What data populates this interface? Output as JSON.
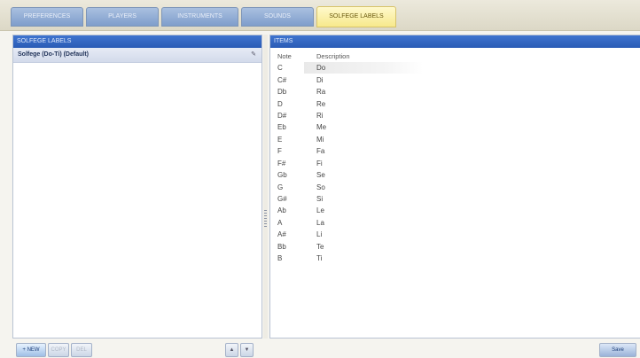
{
  "tabs": [
    {
      "label": "PREFERENCES"
    },
    {
      "label": "PLAYERS"
    },
    {
      "label": "INSTRUMENTS"
    },
    {
      "label": "SOUNDS"
    },
    {
      "label": "SOLFEGE LABELS"
    }
  ],
  "left_panel": {
    "title": "SOLFEGE LABELS",
    "sets": [
      {
        "label": "Solfege (Do-Ti) (Default)",
        "action_icon": "pencil-icon",
        "action_glyph": "✎"
      }
    ],
    "buttons": {
      "new": "+ NEW",
      "copy": "COPY",
      "delete": "DEL",
      "move_up": "▲",
      "move_down": "▼"
    }
  },
  "right_panel": {
    "title": "ITEMS",
    "columns": {
      "note": "Note",
      "description": "Description"
    },
    "rows": [
      {
        "note": "C",
        "desc": "Do"
      },
      {
        "note": "C#",
        "desc": "Di"
      },
      {
        "note": "Db",
        "desc": "Ra"
      },
      {
        "note": "D",
        "desc": "Re"
      },
      {
        "note": "D#",
        "desc": "Ri"
      },
      {
        "note": "Eb",
        "desc": "Me"
      },
      {
        "note": "E",
        "desc": "Mi"
      },
      {
        "note": "F",
        "desc": "Fa"
      },
      {
        "note": "F#",
        "desc": "Fi"
      },
      {
        "note": "Gb",
        "desc": "Se"
      },
      {
        "note": "G",
        "desc": "So"
      },
      {
        "note": "G#",
        "desc": "Si"
      },
      {
        "note": "Ab",
        "desc": "Le"
      },
      {
        "note": "A",
        "desc": "La"
      },
      {
        "note": "A#",
        "desc": "Li"
      },
      {
        "note": "Bb",
        "desc": "Te"
      },
      {
        "note": "B",
        "desc": "Ti"
      }
    ],
    "buttons": {
      "save": "Save"
    }
  },
  "colors": {
    "header_blue": "#2f64c0",
    "active_tab": "#f7e98c",
    "inactive_tab": "#8aa6d2"
  }
}
